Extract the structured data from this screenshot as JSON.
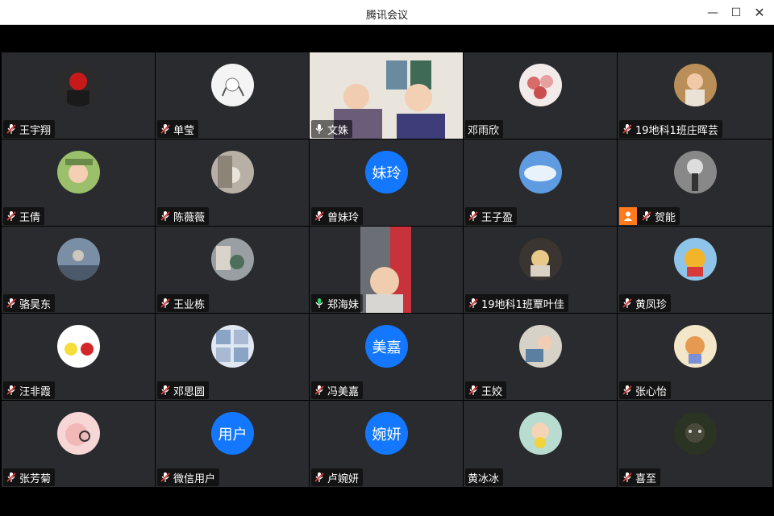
{
  "window": {
    "title": "腾讯会议",
    "minimize": "—",
    "maximize": "☐",
    "close": "✕"
  },
  "participants": [
    {
      "name": "王宇翔",
      "mic": "muted",
      "avatar": "red-mask-photo"
    },
    {
      "name": "单莹",
      "mic": "muted",
      "avatar": "sketch-girl"
    },
    {
      "name": "文姝",
      "mic": "on",
      "avatar": "camera-video"
    },
    {
      "name": "邓雨欣",
      "mic": "none",
      "avatar": "cartoon-group"
    },
    {
      "name": "19地科1班庄晖芸",
      "mic": "muted",
      "avatar": "girl-photo"
    },
    {
      "name": "王倩",
      "mic": "muted",
      "avatar": "child-photo"
    },
    {
      "name": "陈薇薇",
      "mic": "muted",
      "avatar": "cat-photo"
    },
    {
      "name": "曾妹玲",
      "mic": "muted",
      "avatar_text": "妹玲"
    },
    {
      "name": "王子盈",
      "mic": "muted",
      "avatar": "sky-photo"
    },
    {
      "name": "贺能",
      "mic": "muted",
      "avatar": "bw-photo",
      "host": true
    },
    {
      "name": "骆昊东",
      "mic": "muted",
      "avatar": "landscape-photo"
    },
    {
      "name": "王业栋",
      "mic": "muted",
      "avatar": "street-photo"
    },
    {
      "name": "郑海妹",
      "mic": "speaking",
      "avatar": "camera-video",
      "active": true
    },
    {
      "name": "19地科1班覃叶佳",
      "mic": "muted",
      "avatar": "cat-photo-2"
    },
    {
      "name": "黄凤珍",
      "mic": "muted",
      "avatar": "pooh-cartoon"
    },
    {
      "name": "汪非霞",
      "mic": "muted",
      "avatar": "pikachu-cartoon"
    },
    {
      "name": "邓思圆",
      "mic": "muted",
      "avatar": "collage-photo"
    },
    {
      "name": "冯美嘉",
      "mic": "muted",
      "avatar_text": "美嘉"
    },
    {
      "name": "王姣",
      "mic": "muted",
      "avatar": "girl-desk-photo"
    },
    {
      "name": "张心怡",
      "mic": "muted",
      "avatar": "fox-cartoon"
    },
    {
      "name": "张芳菊",
      "mic": "muted",
      "avatar": "pig-cartoon"
    },
    {
      "name": "微信用户",
      "mic": "muted",
      "avatar_text": "用户"
    },
    {
      "name": "卢婉妍",
      "mic": "muted",
      "avatar_text": "婉妍"
    },
    {
      "name": "黄冰冰",
      "mic": "none",
      "avatar": "baby-photo"
    },
    {
      "name": "喜至",
      "mic": "muted",
      "avatar": "bear-photo"
    }
  ],
  "colors": {
    "avatar_blue": "#1378ff",
    "mute_red": "#e53935",
    "speaking_green": "#26d66b",
    "host_orange": "#ff7a1a"
  }
}
